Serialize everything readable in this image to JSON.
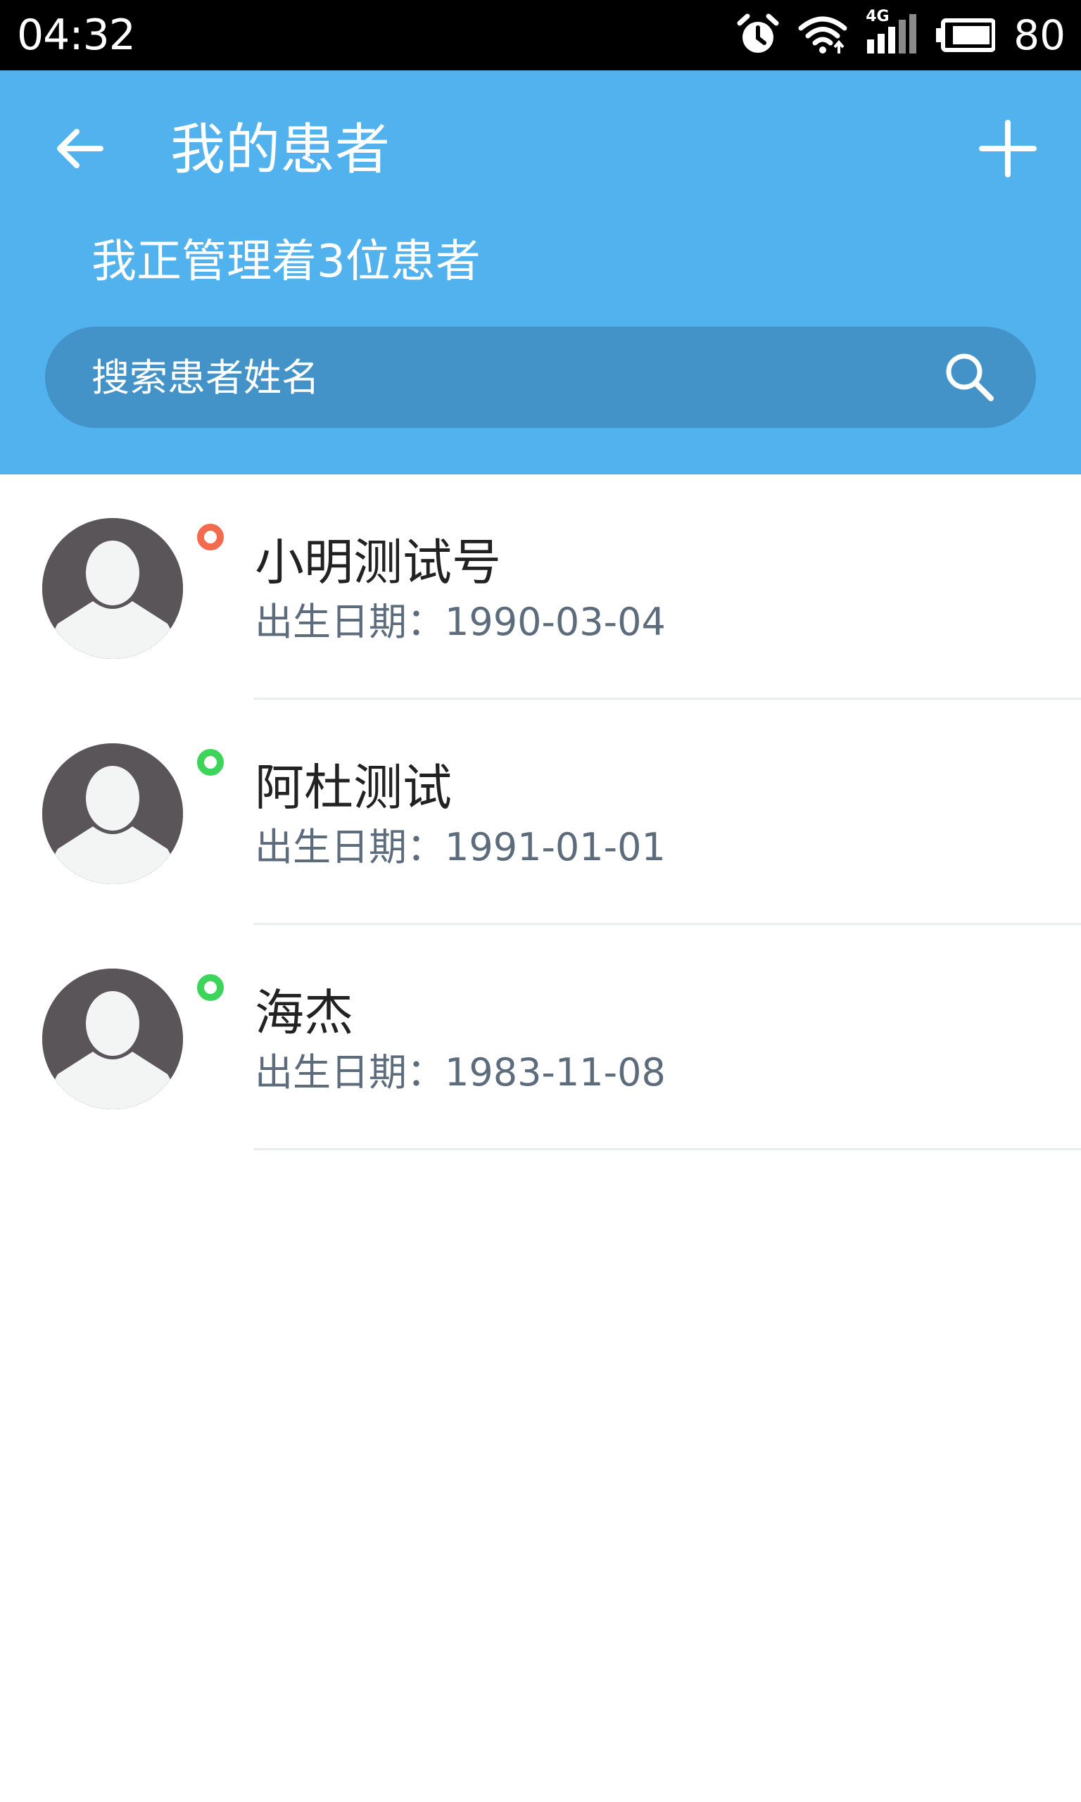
{
  "status_bar": {
    "time": "04:32",
    "icons": [
      "alarm-icon",
      "wifi-icon",
      "signal-4g-icon",
      "battery-icon"
    ],
    "network_label": "4G",
    "battery_level": "80"
  },
  "header": {
    "title": "我的患者",
    "subtitle": "我正管理着3位患者",
    "back_icon": "arrow-left-icon",
    "add_icon": "plus-icon",
    "background_color": "#52b2ee"
  },
  "search": {
    "placeholder": "搜索患者姓名",
    "value": "",
    "icon": "search-icon",
    "background_color": "#4393c8"
  },
  "patients": [
    {
      "name": "小明测试号",
      "birth_label": "出生日期：1990-03-04",
      "status_color": "#f26b4f"
    },
    {
      "name": "阿杜测试",
      "birth_label": "出生日期：1991-01-01",
      "status_color": "#3ed45a"
    },
    {
      "name": "海杰",
      "birth_label": "出生日期：1983-11-08",
      "status_color": "#3ed45a"
    }
  ]
}
